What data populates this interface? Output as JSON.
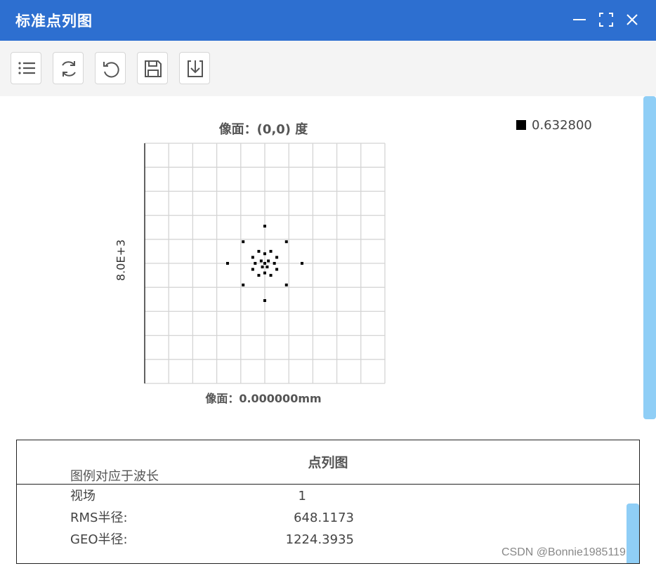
{
  "window": {
    "title": "标准点列图"
  },
  "toolbar": {
    "buttons": [
      {
        "icon": "list-icon"
      },
      {
        "icon": "refresh-icon"
      },
      {
        "icon": "undo-icon"
      },
      {
        "icon": "save-icon"
      },
      {
        "icon": "download-icon"
      }
    ]
  },
  "chart_data": {
    "type": "scatter",
    "title": "像面：(0,0) 度",
    "xlabel": "像面：0.000000mm",
    "ylabel": "8.0E+3",
    "grid": true,
    "legend_position": "top-right",
    "xlim": [
      -5,
      5
    ],
    "ylim": [
      -5,
      5
    ],
    "series": [
      {
        "name": "0.632800",
        "color": "#000000",
        "points": [
          [
            0,
            0
          ],
          [
            0.15,
            0.1
          ],
          [
            -0.15,
            0.1
          ],
          [
            0.1,
            -0.15
          ],
          [
            -0.1,
            -0.15
          ],
          [
            0,
            0.4
          ],
          [
            0,
            -0.4
          ],
          [
            0.4,
            0
          ],
          [
            -0.4,
            0
          ],
          [
            -0.25,
            0.5
          ],
          [
            0.25,
            0.5
          ],
          [
            -0.25,
            -0.5
          ],
          [
            0.25,
            -0.5
          ],
          [
            -0.5,
            0.25
          ],
          [
            0.5,
            0.25
          ],
          [
            -0.5,
            -0.25
          ],
          [
            0.5,
            -0.25
          ],
          [
            0,
            1.55
          ],
          [
            0,
            -1.55
          ],
          [
            -1.55,
            0
          ],
          [
            1.55,
            0
          ],
          [
            -0.9,
            0.9
          ],
          [
            0.9,
            0.9
          ],
          [
            -0.9,
            -0.9
          ],
          [
            0.9,
            -0.9
          ]
        ]
      }
    ]
  },
  "panel": {
    "title": "点列图",
    "partial_line": "图例对应于波长",
    "rows": [
      {
        "label": "视场",
        "value": "1"
      },
      {
        "label": "RMS半径:",
        "value": "648.1173"
      },
      {
        "label": "GEO半径:",
        "value": "1224.3935"
      }
    ]
  },
  "watermark": "CSDN @Bonnie1985119"
}
